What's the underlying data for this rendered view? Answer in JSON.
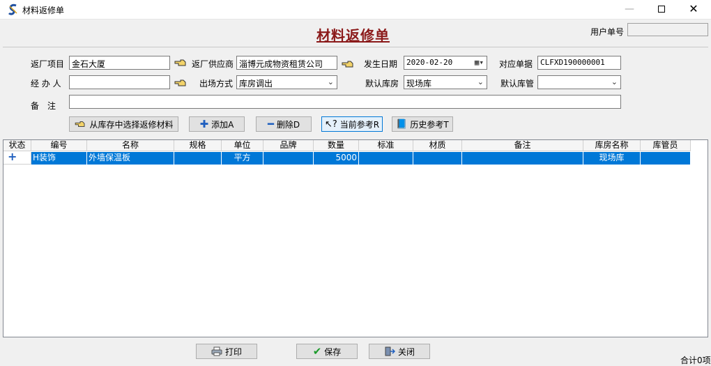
{
  "window": {
    "title": "材料返修单"
  },
  "header": {
    "doc_title": "材料返修单",
    "user_no_label": "用户单号",
    "user_no_value": ""
  },
  "form": {
    "project_label": "返厂项目",
    "project_value": "金石大厦",
    "supplier_label": "返厂供应商",
    "supplier_value": "淄博元成物资租赁公司",
    "date_label": "发生日期",
    "date_value": "2020-02-20",
    "ref_label": "对应单据",
    "ref_value": "CLFXD190000001",
    "handler_label": "经 办 人",
    "handler_value": "",
    "exit_mode_label": "出场方式",
    "exit_mode_value": "库房调出",
    "warehouse_label": "默认库房",
    "warehouse_value": "现场库",
    "keeper_label": "默认库管",
    "keeper_value": "",
    "note_label": "备　注",
    "note_value": ""
  },
  "toolbar": {
    "select_label": "从库存中选择返修材料",
    "add_label": "添加A",
    "delete_label": "删除D",
    "current_ref_label": "当前参考R",
    "history_ref_label": "历史参考T"
  },
  "table": {
    "columns": [
      "状态",
      "编号",
      "名称",
      "规格",
      "单位",
      "品牌",
      "数量",
      "标准",
      "材质",
      "备注",
      "库房名称",
      "库管员"
    ],
    "rows": [
      {
        "status": "+",
        "code": "H装饰",
        "name": "外墙保温板",
        "spec": "",
        "unit": "平方",
        "brand": "",
        "qty": "5000",
        "standard": "",
        "material": "",
        "note": "",
        "warehouse": "现场库",
        "keeper": ""
      }
    ]
  },
  "footer": {
    "print_label": "打印",
    "save_label": "保存",
    "close_label": "关闭",
    "total_text": "合计0项"
  },
  "colors": {
    "title": "#8b1a1a",
    "selection": "#0078d7"
  }
}
